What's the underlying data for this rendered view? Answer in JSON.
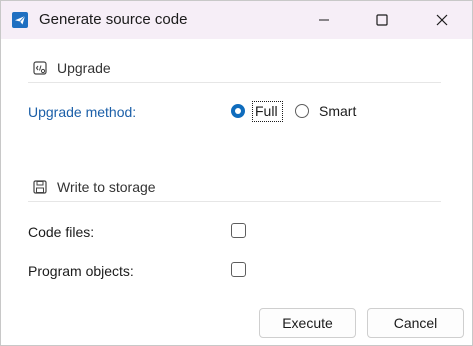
{
  "window": {
    "title": "Generate source code",
    "icon": "send-icon"
  },
  "titlebar_buttons": [
    "minimize-icon",
    "maximize-icon",
    "close-icon"
  ],
  "upgrade_section": {
    "title": "Upgrade",
    "icon": "code-settings-icon",
    "method_label": "Upgrade method:",
    "options": [
      {
        "label": "Full",
        "selected": true
      },
      {
        "label": "Smart",
        "selected": false
      }
    ]
  },
  "storage_section": {
    "title": "Write to storage",
    "icon": "save-icon",
    "items": [
      {
        "label": "Code files:",
        "checked": false
      },
      {
        "label": "Program objects:",
        "checked": false
      }
    ]
  },
  "buttons": {
    "execute": "Execute",
    "cancel": "Cancel"
  },
  "colors": {
    "accent": "#0f6cbd",
    "label_accent": "#1b5fa8",
    "titlebar_bg": "#f6eef7"
  }
}
